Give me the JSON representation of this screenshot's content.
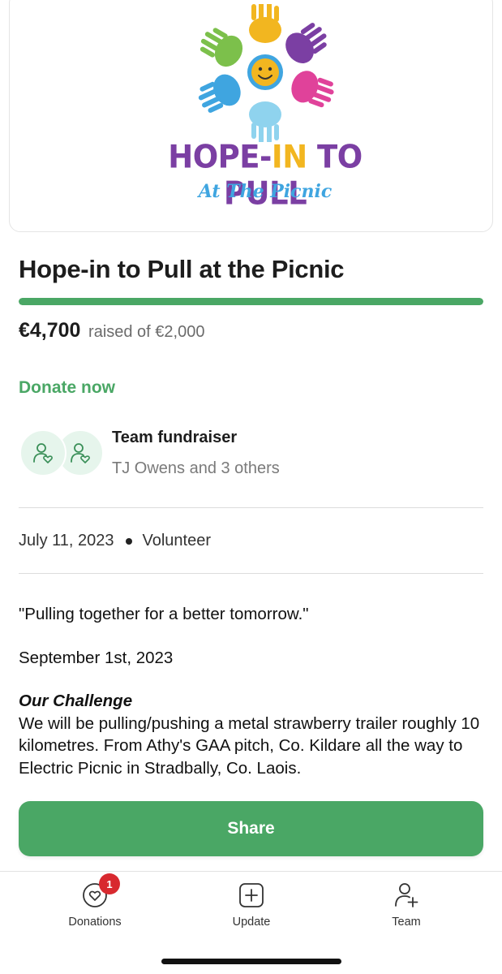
{
  "hero": {
    "logo_title_part1": "HOPE-",
    "logo_title_part2": "IN",
    "logo_title_part3": " TO PULL",
    "logo_subtitle": "At The Picnic"
  },
  "campaign": {
    "title": "Hope-in to Pull at the Picnic",
    "raised_amount": "€4,700",
    "raised_text": "raised of €2,000",
    "progress_fraction": 1.0,
    "donate_label": "Donate now"
  },
  "team": {
    "title": "Team fundraiser",
    "subtitle": "TJ Owens and 3 others"
  },
  "meta": {
    "date": "July 11, 2023",
    "category": "Volunteer"
  },
  "story": {
    "quote": "\"Pulling together for a better tomorrow.\"",
    "date_line": "September 1st, 2023",
    "heading": "Our Challenge",
    "body": "We will be pulling/pushing a metal strawberry trailer roughly 10 kilometres. From Athy's GAA pitch, Co. Kildare all the way to Electric Picnic in Stradbally, Co. Laois."
  },
  "share_label": "Share",
  "tabbar": {
    "donations_label": "Donations",
    "donations_badge": "1",
    "update_label": "Update",
    "team_label": "Team"
  },
  "colors": {
    "accent": "#4aa765",
    "badge": "#d8292f",
    "logo_purple": "#7b3fa3",
    "logo_blue": "#3fa5e0",
    "logo_yellow": "#f2b620"
  }
}
